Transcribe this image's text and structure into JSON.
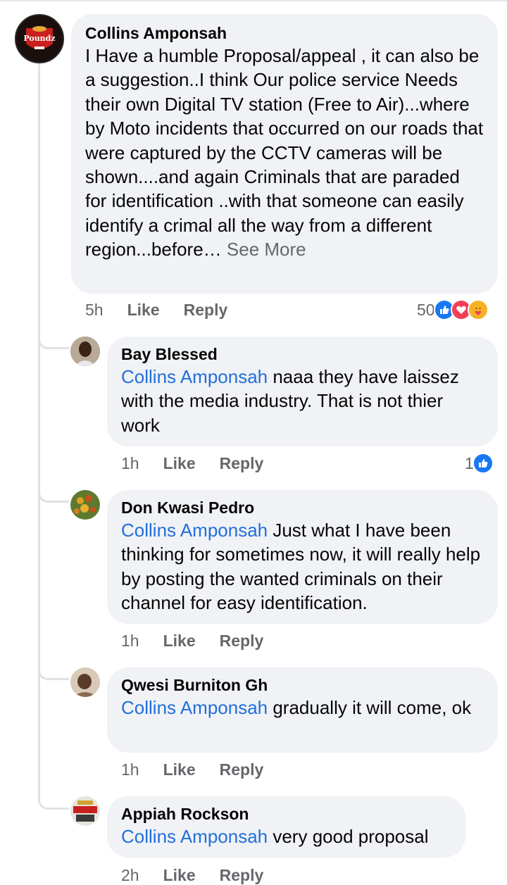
{
  "comments": [
    {
      "author": "Collins Amponsah",
      "text": "I Have a humble Proposal/appeal , it can also be a suggestion..I think Our  police service Needs their own Digital TV  station (Free to Air)...where by Moto incidents that occurred on our roads that were captured by the CCTV cameras will be shown....and again Criminals that are paraded for identification ..with that someone can easily identify a crimal all the way from a different region...before… ",
      "see_more": "See More",
      "time": "5h",
      "like_label": "Like",
      "reply_label": "Reply",
      "reaction_count": "50",
      "reactions": [
        "like-icon",
        "love-icon",
        "care-icon"
      ],
      "avatar_text": {
        "line1": "Ak",
        "line2": "Poundz",
        "line3": "SHITOR"
      }
    }
  ],
  "replies": [
    {
      "author": "Bay Blessed",
      "mention": "Collins Amponsah",
      "text": "  naaa they have laissez with the media industry. That is not thier work",
      "time": "1h",
      "like_label": "Like",
      "reply_label": "Reply",
      "reaction_count": "1"
    },
    {
      "author": "Don Kwasi Pedro",
      "mention": "Collins Amponsah",
      "text": " Just what I have been thinking for sometimes now, it will really help by posting the wanted criminals on their channel for easy identification.",
      "time": "1h",
      "like_label": "Like",
      "reply_label": "Reply"
    },
    {
      "author": "Qwesi Burniton Gh",
      "mention": "Collins Amponsah",
      "text": " gradually it will come, ok",
      "time": "1h",
      "like_label": "Like",
      "reply_label": "Reply"
    },
    {
      "author": "Appiah Rockson",
      "mention": "Collins Amponsah",
      "text": " very good proposal",
      "time": "2h",
      "like_label": "Like",
      "reply_label": "Reply"
    }
  ],
  "colors": {
    "bubble": "#f0f2f5",
    "mention": "#216fdb",
    "muted": "#65676b",
    "like": "#1877f2",
    "love": "#f33e58",
    "care": "#f7b125"
  }
}
